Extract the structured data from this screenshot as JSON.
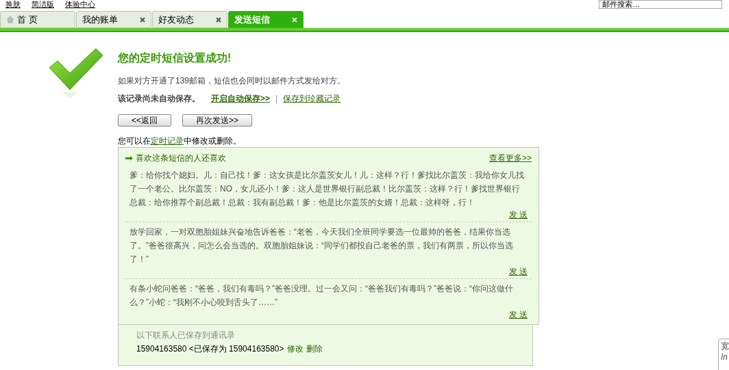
{
  "top_links": [
    "换肤",
    "简洁版",
    "体验中心"
  ],
  "search": {
    "placeholder": "邮件搜索…"
  },
  "tabs": [
    {
      "label": "首 页",
      "kind": "home",
      "selected": false
    },
    {
      "label": "我的账单",
      "kind": "closable",
      "selected": false
    },
    {
      "label": "好友动态",
      "kind": "closable",
      "selected": false
    },
    {
      "label": "发送短信",
      "kind": "closable",
      "selected": true
    }
  ],
  "result": {
    "title": "您的定时短信设置成功!",
    "note": "如果对方开通了139邮箱，短信也会同时以邮件方式发给对方。",
    "unsaved": "该记录尚未自动保存。",
    "auto_save_link": "开启自动保存>>",
    "separator": "|",
    "favorite_link": "保存到珍藏记录",
    "buttons": [
      "<<返回",
      "再次发送>>"
    ],
    "edit_prefix": "您可以在",
    "edit_link": "定时记录",
    "edit_suffix": "中修改或删除。"
  },
  "recommend": {
    "title": "喜欢这条短信的人还喜欢",
    "more": "查看更多>>",
    "items": [
      {
        "text": "爹：给你找个媳妇。儿：自己找！爹：这女孩是比尔盖茨女儿！儿：这样？行！爹找比尔盖茨：我给你女儿找了一个老公。比尔盖茨：NO，女儿还小！爹：这人是世界银行副总裁！比尔盖茨：这样？行！爹找世界银行总裁：给你推荐个副总裁！总裁：我有副总裁！爹：他是比尔盖茨的女婿！总裁：这样呀，行！",
        "send": "发 送"
      },
      {
        "text": "放学回家，一对双胞胎姐妹兴奋地告诉爸爸：“老爸，今天我们全班同学要选一位最帅的爸爸，结果你当选了。”爸爸很高兴，问怎么会当选的。双胞胎姐妹说：“同学们都投自己老爸的票，我们有两票，所以你当选了！”",
        "send": "发 送"
      },
      {
        "text": "有条小蛇问爸爸：“爸爸，我们有毒吗？”爸爸没理。过一会又问：“爸爸我们有毒吗？”爸爸说：“你问这做什么？”小蛇：“我刚不小心咬到舌头了……”",
        "send": "发 送"
      }
    ]
  },
  "contacts": {
    "title": "以下联系人已保存到通讯录",
    "entry": "15904163580 <已保存为 15904163580>",
    "edit": "修改",
    "delete": "删除"
  },
  "popup": {
    "line_1": "宽",
    "line_2": "In"
  }
}
